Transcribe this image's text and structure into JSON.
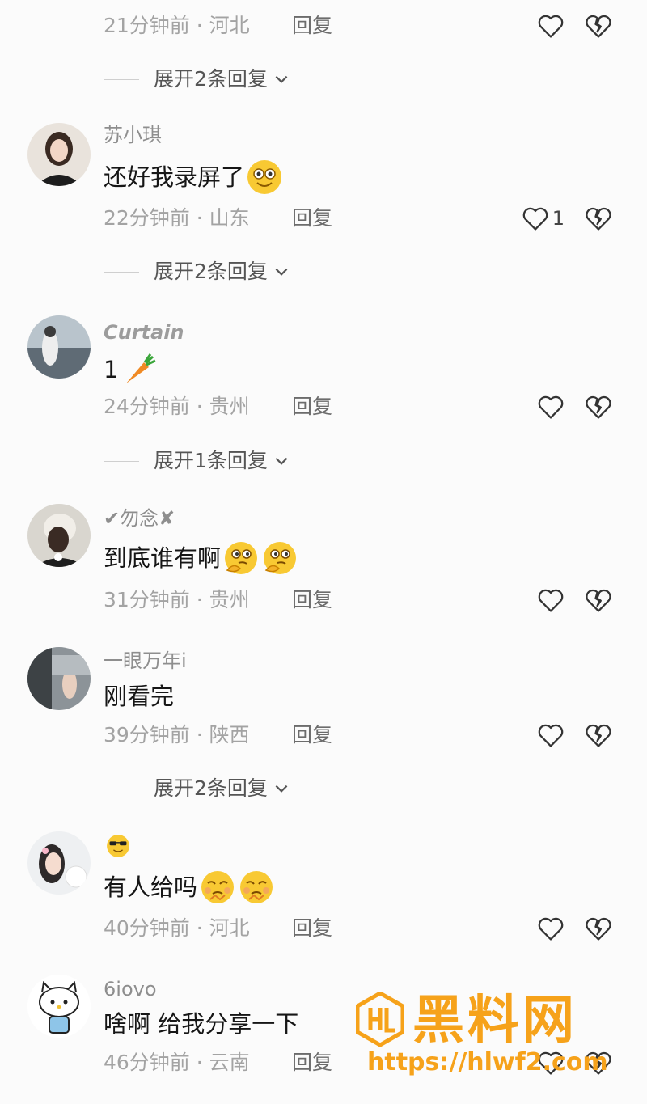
{
  "colors": {
    "accent": "#f6a21a",
    "muted": "#a3a3a3",
    "text": "#161616"
  },
  "comments": [
    {
      "username": "",
      "text": "",
      "time": "21分钟前 · 河北",
      "reply": "回复",
      "likes": "",
      "expand": "展开2条回复"
    },
    {
      "username": "苏小琪",
      "text": "还好我录屏了",
      "emoji": "smile",
      "time": "22分钟前 · 山东",
      "reply": "回复",
      "likes": "1",
      "expand": "展开2条回复"
    },
    {
      "username": "Curtain",
      "text": "1",
      "emoji": "carrot",
      "time": "24分钟前 · 贵州",
      "reply": "回复",
      "likes": "",
      "expand": "展开1条回复"
    },
    {
      "username": "✔勿念✘",
      "text": "到底谁有啊",
      "emoji": "thinking",
      "time": "31分钟前 · 贵州",
      "reply": "回复",
      "likes": "",
      "expand": ""
    },
    {
      "username": "一眼万年i",
      "text": "刚看完",
      "time": "39分钟前 · 陕西",
      "reply": "回复",
      "likes": "",
      "expand": "展开2条回复"
    },
    {
      "username": "",
      "username_emoji": "cool",
      "text": "有人给吗",
      "emoji": "pleading",
      "time": "40分钟前 · 河北",
      "reply": "回复",
      "likes": "",
      "expand": ""
    },
    {
      "username": "6iovo",
      "text": "啥啊 给我分享一下",
      "time": "46分钟前 · 云南",
      "reply": "回复",
      "likes": "",
      "expand": ""
    }
  ],
  "watermark": {
    "text": "黑料网",
    "url": "https://hlwf2.com"
  }
}
